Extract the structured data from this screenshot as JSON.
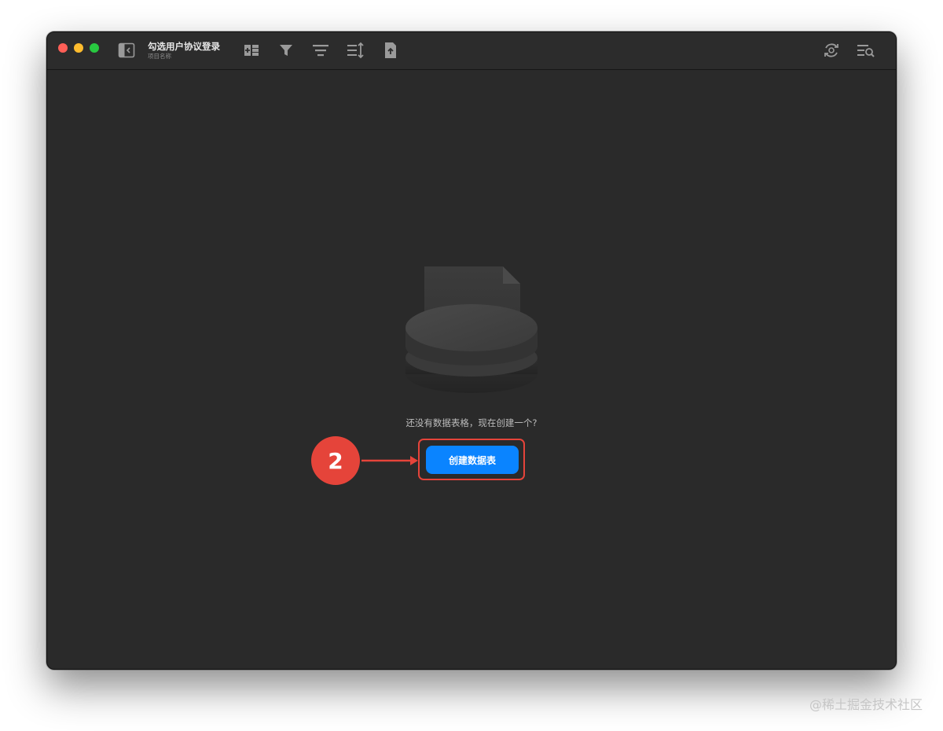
{
  "window": {
    "title": "勾选用户协议登录",
    "subtitle": "项目名称"
  },
  "toolbar": {
    "icons": [
      "sidebar-toggle-icon",
      "add-field-icon",
      "filter-icon",
      "group-icon",
      "sort-icon",
      "export-icon",
      "refresh-icon",
      "search-list-icon"
    ]
  },
  "empty_state": {
    "message": "还没有数据表格，现在创建一个?",
    "create_button_label": "创建数据表"
  },
  "annotation": {
    "step_number": "2",
    "color": "#e5443a"
  },
  "watermark": "@稀土掘金技术社区",
  "colors": {
    "accent": "#0a84ff",
    "background": "#2a2a2a"
  }
}
